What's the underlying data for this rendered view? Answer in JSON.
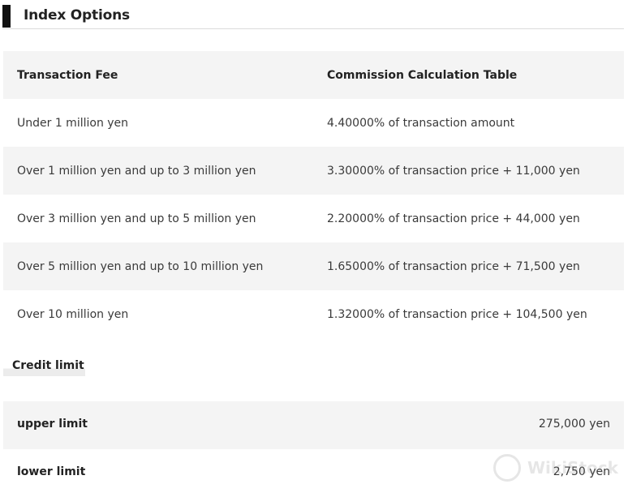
{
  "section": {
    "title": "Index Options"
  },
  "fee_table": {
    "headers": [
      "Transaction Fee",
      "Commission Calculation Table"
    ],
    "rows": [
      {
        "range": "Under 1 million yen",
        "fee": "4.40000% of transaction amount"
      },
      {
        "range": "Over 1 million yen and up to 3 million yen",
        "fee": "3.30000% of transaction price + 11,000 yen"
      },
      {
        "range": "Over 3 million yen and up to 5 million yen",
        "fee": "2.20000% of transaction price + 44,000 yen"
      },
      {
        "range": "Over 5 million yen and up to 10 million yen",
        "fee": "1.65000% of transaction price + 71,500 yen"
      },
      {
        "range": "Over 10 million yen",
        "fee": "1.32000% of transaction price + 104,500 yen"
      }
    ]
  },
  "credit": {
    "title": "Credit limit",
    "rows": [
      {
        "label": "upper limit",
        "value": "275,000 yen"
      },
      {
        "label": "lower limit",
        "value": "2,750 yen"
      }
    ]
  },
  "watermark": {
    "text": "WikiStock",
    "icon": "wikistock-logo-icon"
  },
  "colors": {
    "row_shade": "#f4f4f4",
    "section_bar": "#111111",
    "divider": "#dcdcdc"
  }
}
